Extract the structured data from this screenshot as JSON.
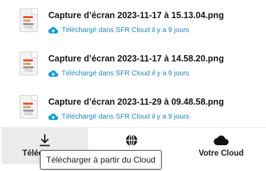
{
  "files": [
    {
      "name": "Capture d’écran 2023-11-17 à 15.13.04.png",
      "status": "Téléchargé dans SFR Cloud il y a 9 jours",
      "thumb_ext": "PNG"
    },
    {
      "name": "Capture d’écran 2023-11-17 à 14.58.20.png",
      "status": "Téléchargé dans SFR Cloud il y a 9 jours",
      "thumb_ext": "PNG"
    },
    {
      "name": "Capture d’écran 2023-11-29 à 09.48.58.png",
      "status": "Téléchargé dans SFR Cloud il y a 9 jours",
      "thumb_ext": "PNG"
    }
  ],
  "actions": {
    "download_label": "Téléc",
    "globe_label": "",
    "cloud_label": "Votre Cloud"
  },
  "tooltip": {
    "text": "Télécharger à partir du Cloud"
  },
  "colors": {
    "status_text": "#1f84b6",
    "cloud_icon": "#1a9ad6",
    "selected_action_bg": "#ebebeb"
  },
  "icons": {
    "status": "cloud-upload-icon",
    "download": "download-icon",
    "globe": "globe-icon",
    "cloud": "cloud-icon"
  }
}
